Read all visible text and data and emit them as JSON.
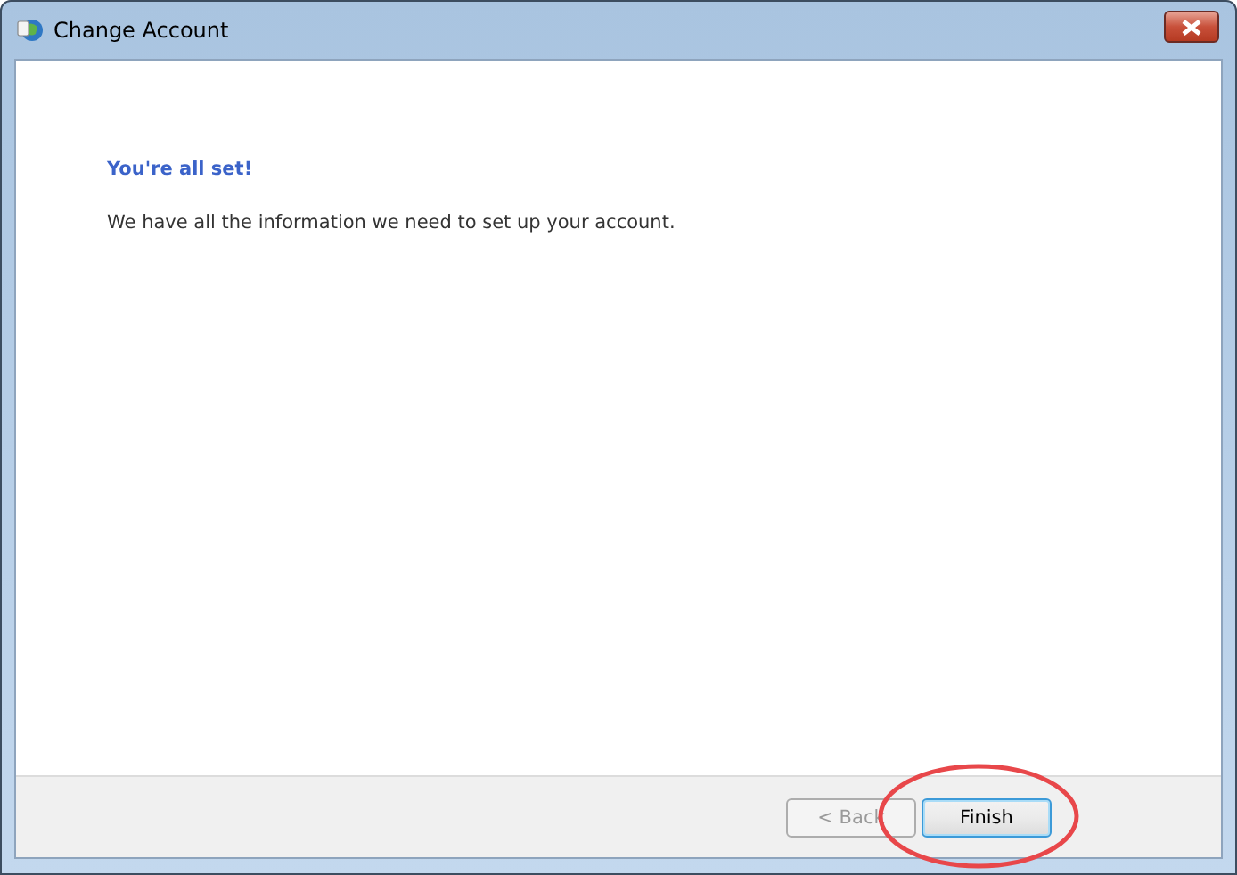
{
  "window": {
    "title": "Change Account"
  },
  "heading": "You're all set!",
  "message": "We have all the information we need to set up your account.",
  "buttons": [
    {
      "label": "< Back",
      "disabled": true,
      "selected": false
    },
    {
      "label": "Finish",
      "disabled": false,
      "selected": true
    }
  ],
  "annotation": {
    "kind": "ellipse",
    "color": "#e8474a"
  }
}
